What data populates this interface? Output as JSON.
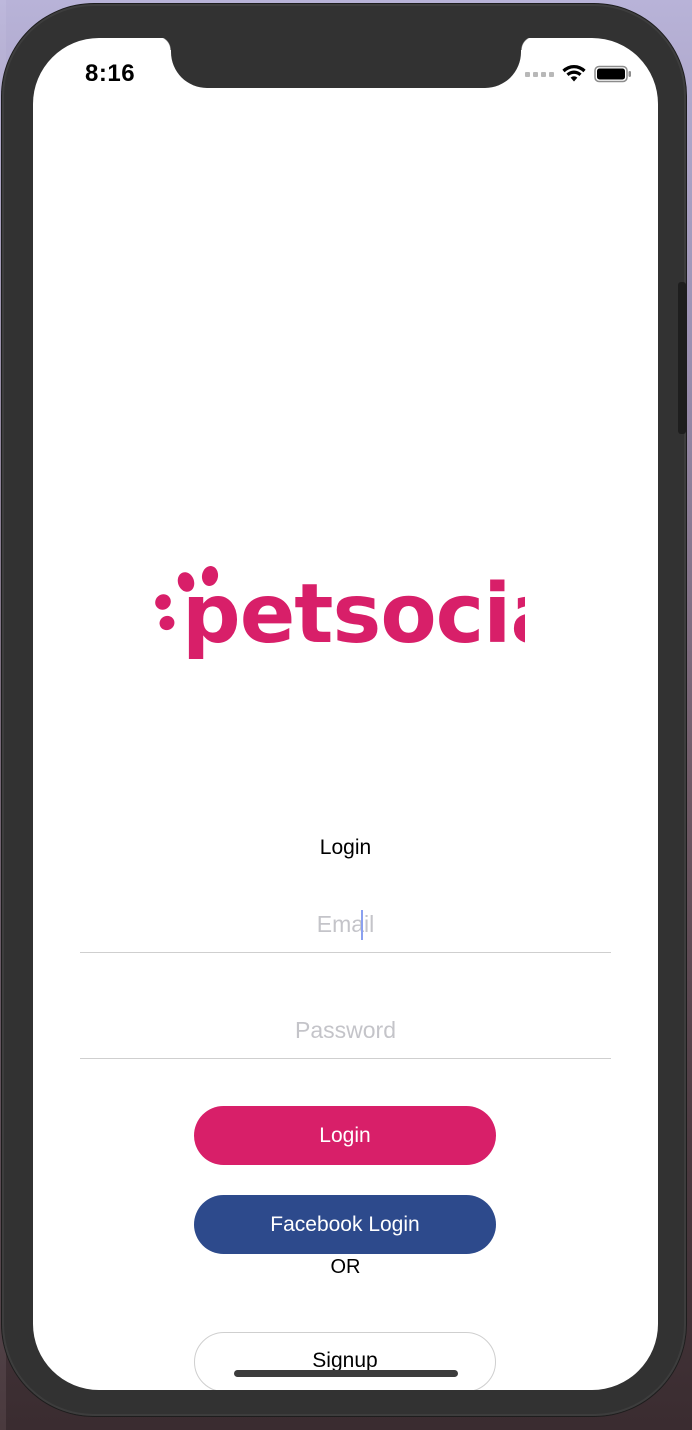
{
  "status_bar": {
    "time": "8:16"
  },
  "brand": {
    "name": "petsocial",
    "color": "#D81F69"
  },
  "login_form": {
    "title": "Login",
    "email_placeholder": "Email",
    "email_value": "",
    "password_placeholder": "Password",
    "password_value": "",
    "login_button_label": "Login",
    "facebook_button_label": "Facebook Login",
    "or_label": "OR",
    "signup_button_label": "Signup"
  },
  "colors": {
    "login_button": "#D81F69",
    "facebook_button": "#2D4A8C",
    "device_frame": "#323232"
  },
  "icons": [
    "wifi-icon",
    "battery-icon",
    "cellular-signal-icon",
    "paw-icon"
  ]
}
